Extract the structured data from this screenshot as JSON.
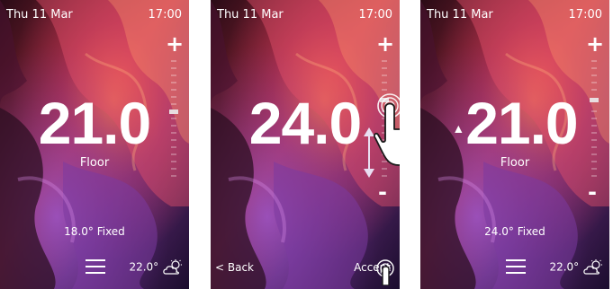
{
  "screens": [
    {
      "date": "Thu 11 Mar",
      "time": "17:00",
      "temperature": "21.0",
      "zone": "Floor",
      "status": "18.0° Fixed",
      "weather_temp": "22.0°",
      "plus": "+",
      "minus": "-"
    },
    {
      "date": "Thu 11 Mar",
      "time": "17:00",
      "temperature": "24.0",
      "plus": "+",
      "minus": "-",
      "back_label": "< Back",
      "accept_label": "Accept"
    },
    {
      "date": "Thu 11 Mar",
      "time": "17:00",
      "temperature": "21.0",
      "zone": "Floor",
      "status": "24.0° Fixed",
      "weather_temp": "22.0°",
      "plus": "+",
      "minus": "-",
      "indicator": "▲"
    }
  ],
  "colors": {
    "text": "#ffffff",
    "accent": "#c93a7a"
  },
  "icons": [
    "menu-icon",
    "weather-cloud-sun-icon",
    "hand-pointer-icon",
    "up-down-arrow-icon",
    "slider-knob-icon"
  ]
}
